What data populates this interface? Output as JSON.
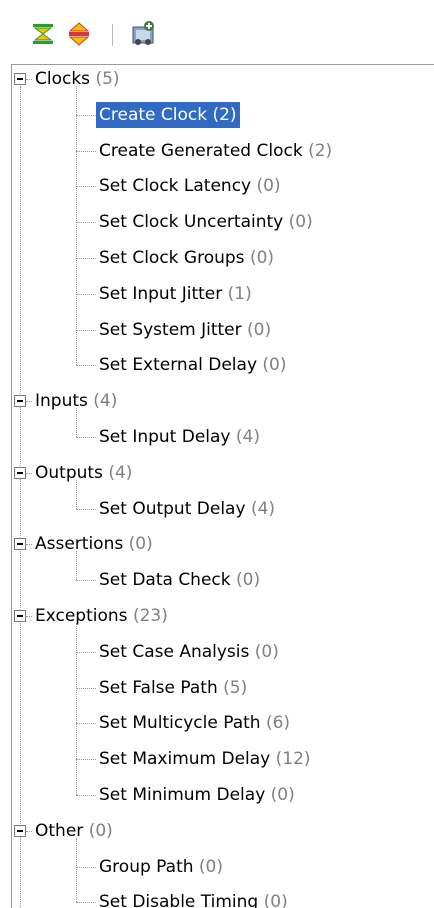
{
  "toolbar": {
    "buttons": [
      {
        "name": "collapse-all-icon",
        "color": "#2f9a2f"
      },
      {
        "name": "expand-all-icon",
        "color": "#d23a3a"
      },
      {
        "name": "add-constraint-icon",
        "color": "#3a7a3a"
      }
    ]
  },
  "colors": {
    "selection": "#316ac5",
    "count_text": "#808080",
    "tree_lines": "#9a9a9a"
  },
  "tree": {
    "groups": [
      {
        "label": "Clocks",
        "count": "(5)",
        "children": [
          {
            "label": "Create Clock",
            "count": "(2)",
            "selected": true
          },
          {
            "label": "Create Generated Clock",
            "count": "(2)"
          },
          {
            "label": "Set Clock Latency",
            "count": "(0)"
          },
          {
            "label": "Set Clock Uncertainty",
            "count": "(0)"
          },
          {
            "label": "Set Clock Groups",
            "count": "(0)"
          },
          {
            "label": "Set Input Jitter",
            "count": "(1)"
          },
          {
            "label": "Set System Jitter",
            "count": "(0)"
          },
          {
            "label": "Set External Delay",
            "count": "(0)"
          }
        ]
      },
      {
        "label": "Inputs",
        "count": "(4)",
        "children": [
          {
            "label": "Set Input Delay",
            "count": "(4)"
          }
        ]
      },
      {
        "label": "Outputs",
        "count": "(4)",
        "children": [
          {
            "label": "Set Output Delay",
            "count": "(4)"
          }
        ]
      },
      {
        "label": "Assertions",
        "count": "(0)",
        "children": [
          {
            "label": "Set Data Check",
            "count": "(0)"
          }
        ]
      },
      {
        "label": "Exceptions",
        "count": "(23)",
        "children": [
          {
            "label": "Set Case Analysis",
            "count": "(0)"
          },
          {
            "label": "Set False Path",
            "count": "(5)"
          },
          {
            "label": "Set Multicycle Path",
            "count": "(6)"
          },
          {
            "label": "Set Maximum Delay",
            "count": "(12)"
          },
          {
            "label": "Set Minimum Delay",
            "count": "(0)"
          }
        ]
      },
      {
        "label": "Other",
        "count": "(0)",
        "children": [
          {
            "label": "Group Path",
            "count": "(0)"
          },
          {
            "label": "Set Disable Timing",
            "count": "(0)"
          }
        ]
      }
    ]
  }
}
